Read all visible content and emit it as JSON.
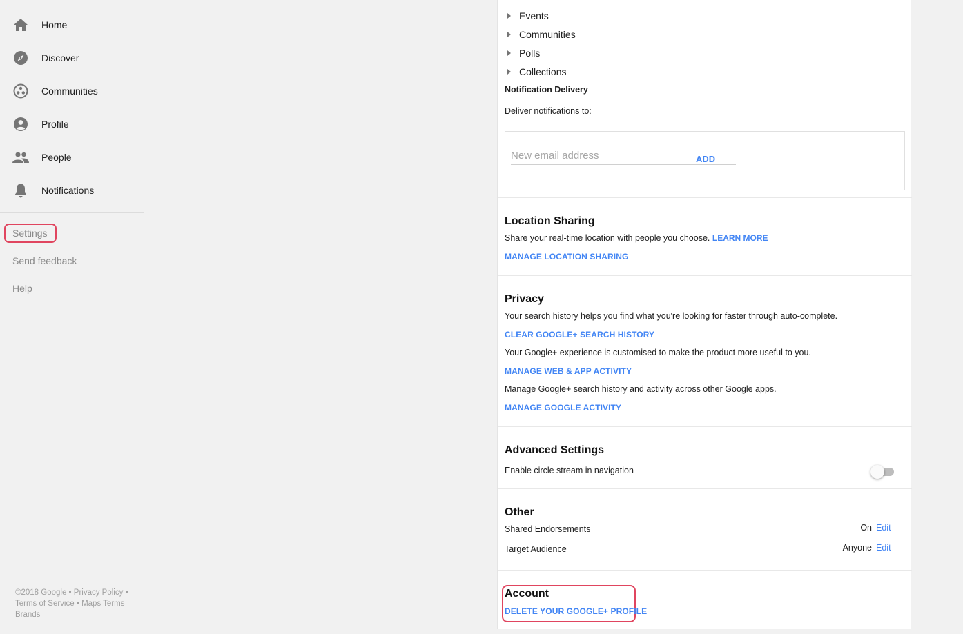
{
  "sidebar": {
    "items": [
      {
        "label": "Home",
        "icon": "home-icon"
      },
      {
        "label": "Discover",
        "icon": "compass-icon"
      },
      {
        "label": "Communities",
        "icon": "communities-icon"
      },
      {
        "label": "Profile",
        "icon": "profile-icon"
      },
      {
        "label": "People",
        "icon": "people-icon"
      },
      {
        "label": "Notifications",
        "icon": "bell-icon"
      }
    ],
    "links": [
      "Settings",
      "Send feedback",
      "Help"
    ],
    "footer": {
      "copyright": "©2018 Google",
      "privacy": "Privacy Policy",
      "terms": "Terms of Service",
      "maps_terms": "Maps Terms",
      "brands": "Brands",
      "sep": "•"
    }
  },
  "notifications": {
    "tree": [
      "Events",
      "Communities",
      "Polls",
      "Collections"
    ],
    "delivery_title": "Notification Delivery",
    "deliver_to": "Deliver notifications to:",
    "email_placeholder": "New email address",
    "add_label": "ADD"
  },
  "location": {
    "title": "Location Sharing",
    "desc": "Share your real-time location with people you choose.",
    "learn_more": "LEARN MORE",
    "manage": "MANAGE LOCATION SHARING"
  },
  "privacy": {
    "title": "Privacy",
    "desc1": "Your search history helps you find what you're looking for faster through auto-complete.",
    "link1": "CLEAR GOOGLE+ SEARCH HISTORY",
    "desc2": "Your Google+ experience is customised to make the product more useful to you.",
    "link2": "MANAGE WEB & APP ACTIVITY",
    "desc3": "Manage Google+ search history and activity across other Google apps.",
    "link3": "MANAGE GOOGLE ACTIVITY"
  },
  "advanced": {
    "title": "Advanced Settings",
    "circle_stream": "Enable circle stream in navigation",
    "circle_stream_enabled": false
  },
  "other": {
    "title": "Other",
    "endorsements_label": "Shared Endorsements",
    "endorsements_value": "On",
    "audience_label": "Target Audience",
    "audience_value": "Anyone",
    "edit_label": "Edit"
  },
  "account": {
    "title": "Account",
    "delete": "DELETE YOUR GOOGLE+ PROFILE"
  },
  "colors": {
    "link": "#4285f4",
    "highlight": "#e0455f"
  }
}
